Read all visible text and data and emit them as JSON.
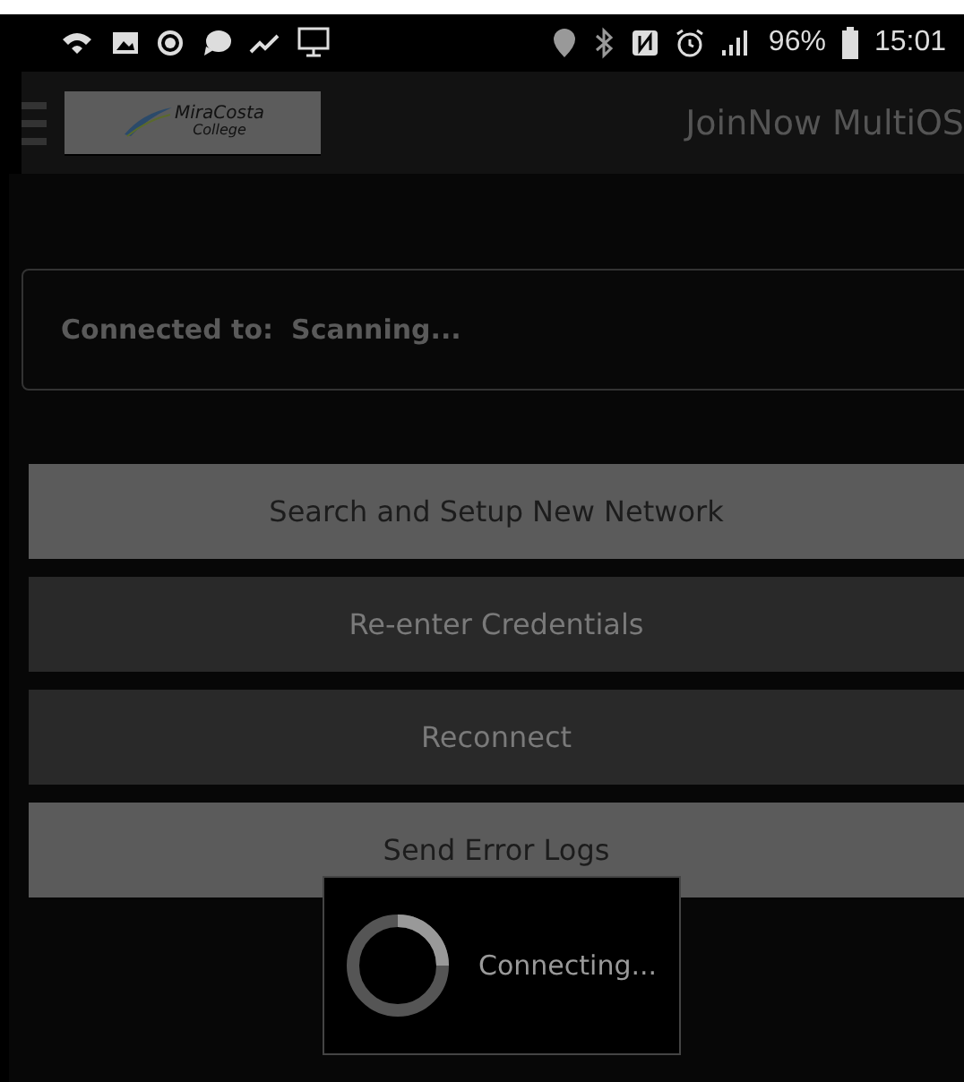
{
  "status_bar": {
    "battery": "96%",
    "time": "15:01"
  },
  "app_bar": {
    "logo": {
      "line_1": "MiraCosta",
      "line_2": "College"
    },
    "title": "JoinNow MultiOS"
  },
  "connection": {
    "label": "Connected to:",
    "value": "Scanning..."
  },
  "buttons": [
    {
      "label": "Search and Setup New Network",
      "disabled": false
    },
    {
      "label": "Re-enter Credentials",
      "disabled": true
    },
    {
      "label": "Reconnect",
      "disabled": true
    },
    {
      "label": "Send Error Logs",
      "disabled": false
    }
  ],
  "dialog": {
    "message": "Connecting..."
  }
}
